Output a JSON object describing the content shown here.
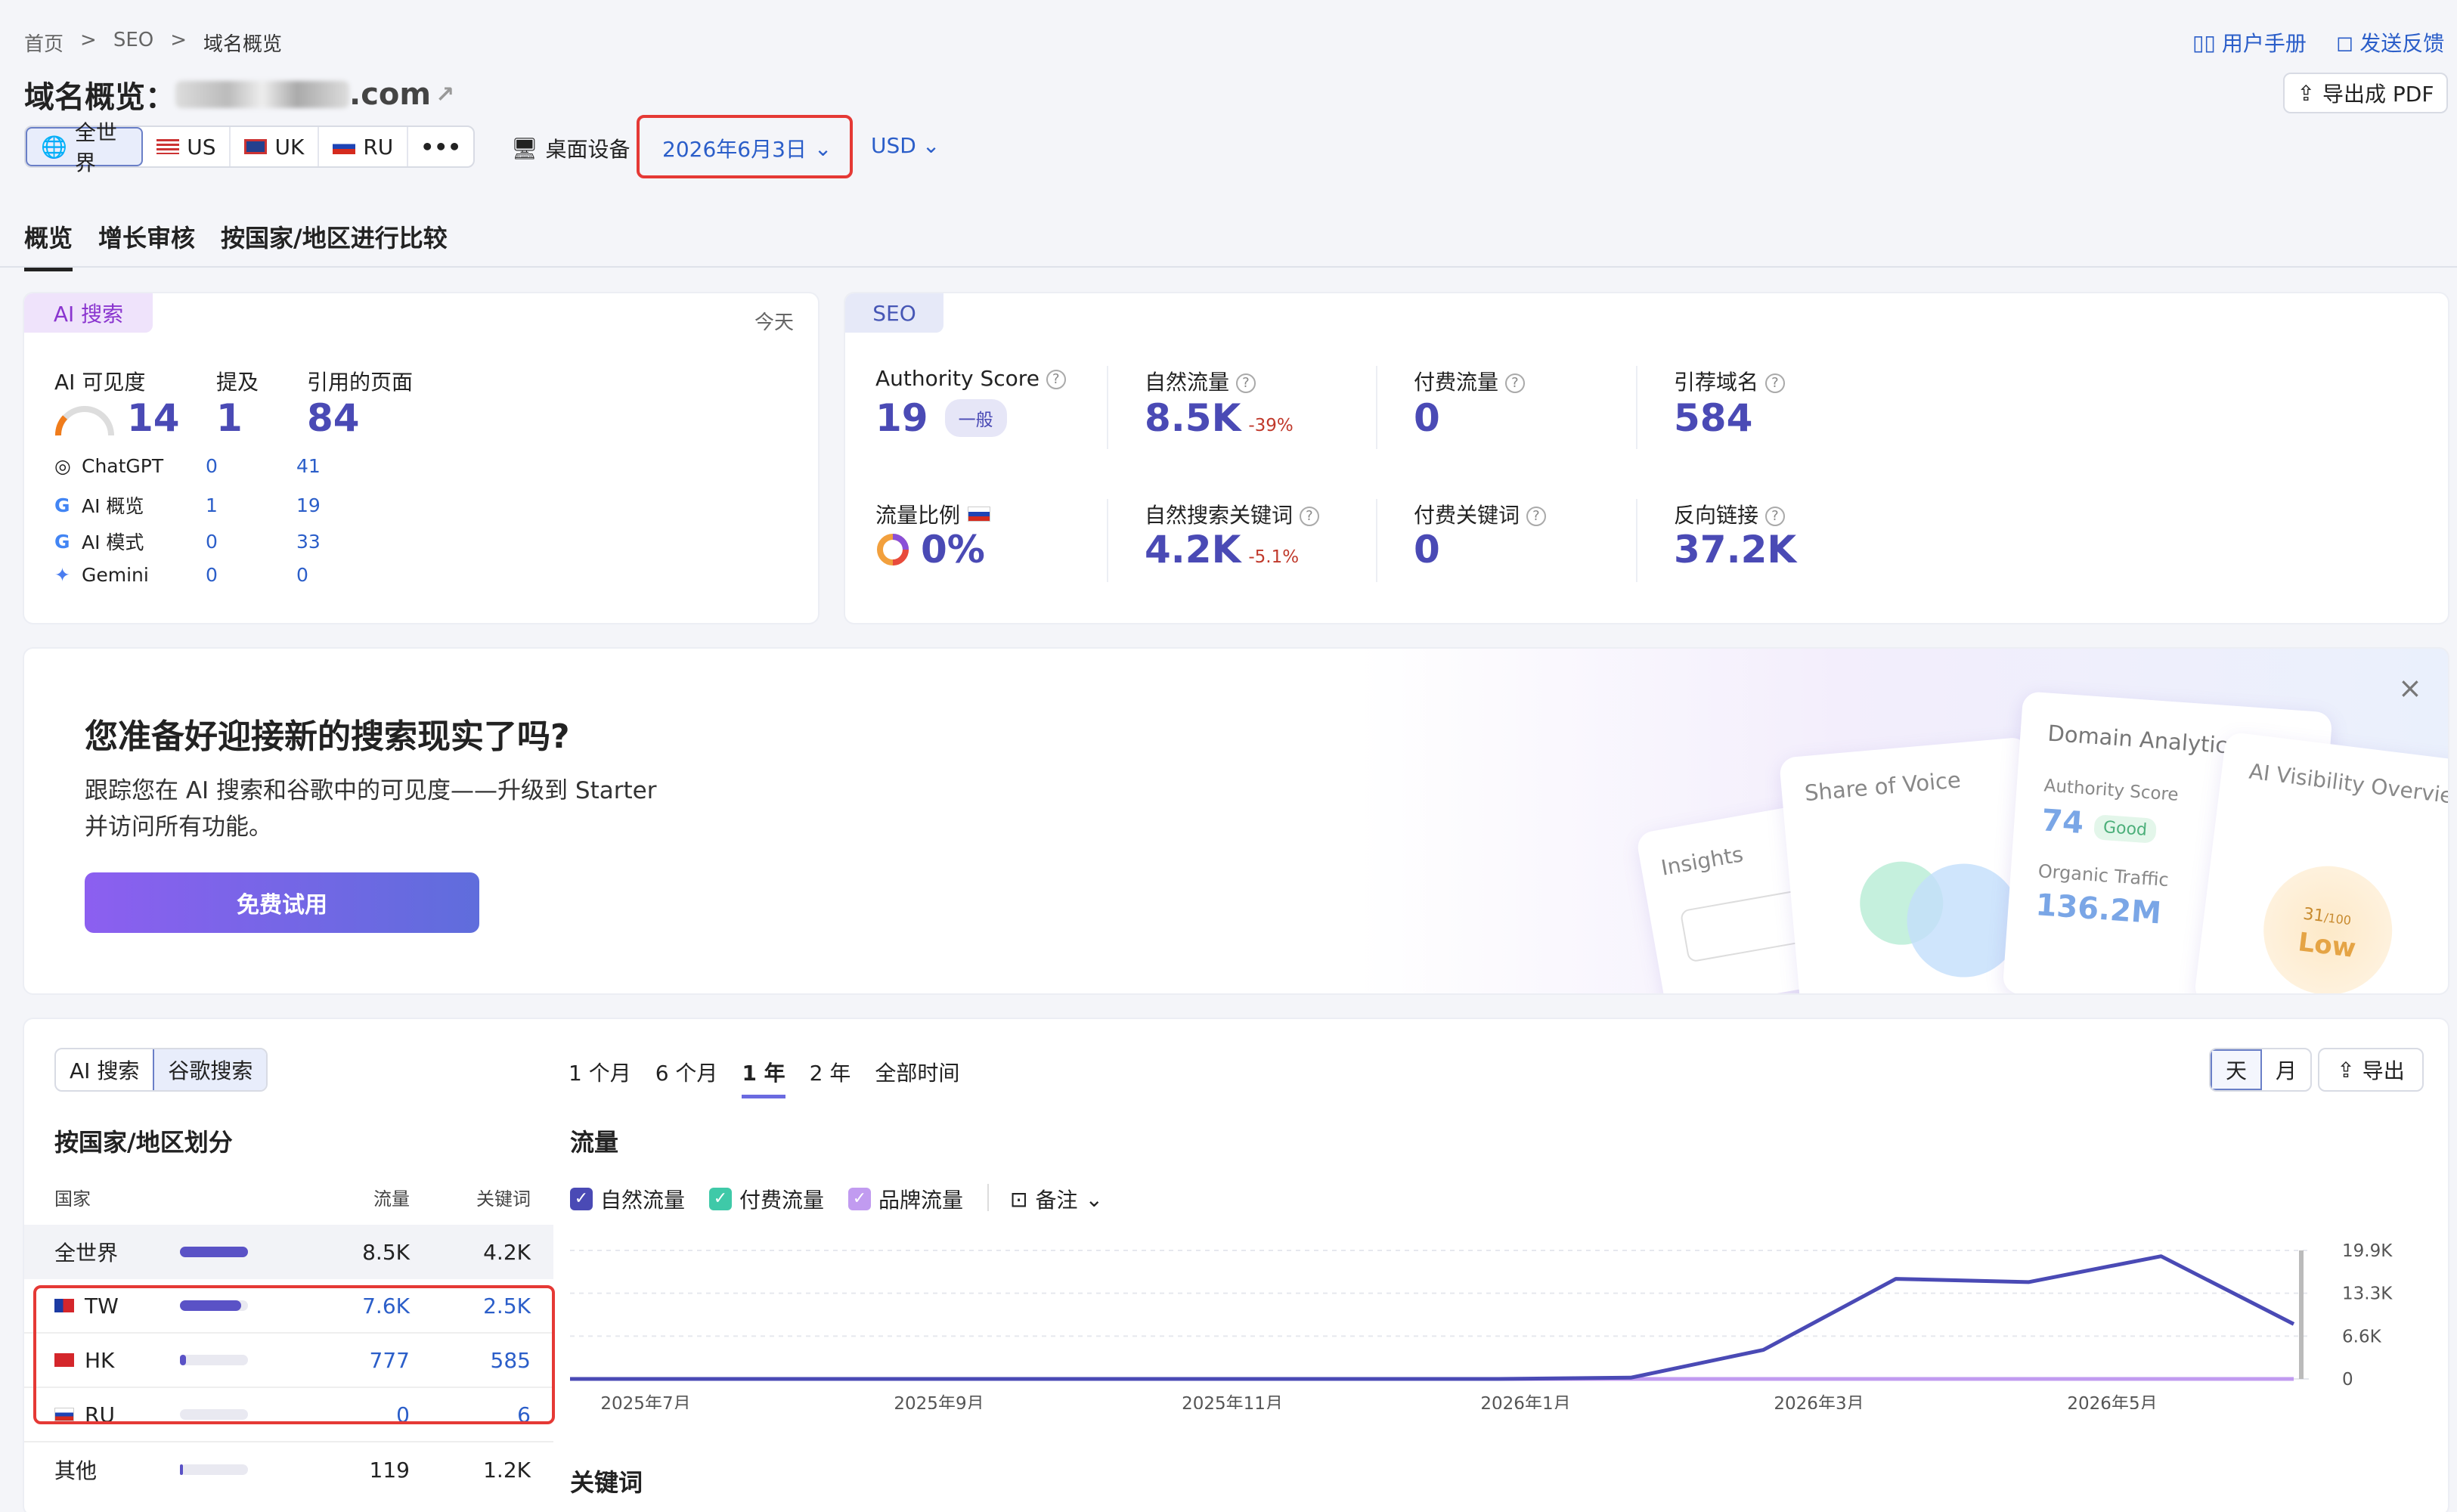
{
  "breadcrumb": {
    "home": "首页",
    "sep": ">",
    "seo": "SEO",
    "current": "域名概览"
  },
  "header": {
    "title": "域名概览：",
    "domain": ".com",
    "user_manual": "用户手册",
    "feedback": "发送反馈",
    "export_pdf": "导出成 PDF"
  },
  "filters": {
    "regions": [
      {
        "label": "全世界",
        "icon": "globe-icon"
      },
      {
        "label": "US",
        "icon": "us-flag-icon"
      },
      {
        "label": "UK",
        "icon": "uk-flag-icon"
      },
      {
        "label": "RU",
        "icon": "ru-flag-icon"
      }
    ],
    "more": "•••",
    "device": "桌面设备",
    "date": "2026年6月3日",
    "currency": "USD"
  },
  "tabs": [
    "概览",
    "增长审核",
    "按国家/地区进行比较"
  ],
  "ai_card": {
    "badge": "AI 搜索",
    "today": "今天",
    "headers": {
      "visibility": "AI 可见度",
      "mentions": "提及",
      "cited": "引用的页面"
    },
    "totals": {
      "visibility": "14",
      "mentions": "1",
      "cited": "84"
    },
    "rows": [
      {
        "name": "ChatGPT",
        "icon": "chatgpt-icon",
        "mentions": "0",
        "cited": "41"
      },
      {
        "name": "AI 概览",
        "icon": "google-icon",
        "mentions": "1",
        "cited": "19"
      },
      {
        "name": "AI 模式",
        "icon": "google-icon",
        "mentions": "0",
        "cited": "33"
      },
      {
        "name": "Gemini",
        "icon": "gemini-icon",
        "mentions": "0",
        "cited": "0"
      }
    ]
  },
  "seo_card": {
    "badge": "SEO",
    "authority_label": "Authority Score",
    "authority_value": "19",
    "authority_tag": "一般",
    "organic_label": "自然流量",
    "organic_value": "8.5K",
    "organic_change": "-39%",
    "paid_label": "付费流量",
    "paid_value": "0",
    "refdomains_label": "引荐域名",
    "refdomains_value": "584",
    "share_label": "流量比例",
    "share_value": "0%",
    "organic_kw_label": "自然搜索关键词",
    "organic_kw_value": "4.2K",
    "organic_kw_change": "-5.1%",
    "paid_kw_label": "付费关键词",
    "paid_kw_value": "0",
    "backlinks_label": "反向链接",
    "backlinks_value": "37.2K"
  },
  "promo": {
    "title": "您准备好迎接新的搜索现实了吗?",
    "line1": "跟踪您在 AI 搜索和谷歌中的可见度——升级到 Starter",
    "line2": "并访问所有功能。",
    "cta": "免费试用",
    "close": "×",
    "illustration": {
      "insights": "Insights",
      "share_voice": "Share of Voice",
      "domain_analytics": "Domain Analytics",
      "authority": "Authority Score",
      "authority_value": "74",
      "authority_tag": "Good",
      "organic": "Organic Traffic",
      "organic_value": "136.2M",
      "ai_vis": "AI Visibility Overview",
      "score": "31",
      "score_max": "/100",
      "low": "Low"
    }
  },
  "bottom": {
    "source_tabs": [
      "AI 搜索",
      "谷歌搜索"
    ],
    "periods": [
      "1 个月",
      "6 个月",
      "1 年",
      "2 年",
      "全部时间"
    ],
    "granularity": [
      "天",
      "月"
    ],
    "export": "导出",
    "country_title": "按国家/地区划分",
    "table_headers": {
      "country": "国家",
      "traffic": "流量",
      "keywords": "关键词"
    },
    "countries": [
      {
        "name": "全世界",
        "traffic": "8.5K",
        "keywords": "4.2K",
        "share": 1.0
      },
      {
        "name": "TW",
        "traffic": "7.6K",
        "keywords": "2.5K",
        "share": 0.9
      },
      {
        "name": "HK",
        "traffic": "777",
        "keywords": "585",
        "share": 0.09
      },
      {
        "name": "RU",
        "traffic": "0",
        "keywords": "6",
        "share": 0.0
      },
      {
        "name": "其他",
        "traffic": "119",
        "keywords": "1.2K",
        "share": 0.02
      }
    ],
    "traffic_title": "流量",
    "legend": [
      "自然流量",
      "付费流量",
      "品牌流量"
    ],
    "notes": "备注",
    "keywords_title": "关键词"
  },
  "chart_data": {
    "type": "line",
    "x": [
      "2025-06",
      "2025-07",
      "2025-08",
      "2025-09",
      "2025-10",
      "2025-11",
      "2025-12",
      "2026-01",
      "2026-02",
      "2026-03",
      "2026-04",
      "2026-05",
      "2026-06"
    ],
    "x_tick_labels": [
      "2025年7月",
      "2025年9月",
      "2025年11月",
      "2026年1月",
      "2026年3月",
      "2026年5月"
    ],
    "y_tick_labels": [
      "19.9K",
      "13.3K",
      "6.6K",
      "0"
    ],
    "ylim": [
      0,
      19900
    ],
    "series": [
      {
        "name": "自然流量",
        "color": "#4a4ab5",
        "values": [
          0,
          0,
          0,
          0,
          0,
          0,
          0,
          0,
          200,
          4500,
          15500,
          15000,
          19000,
          8500
        ]
      },
      {
        "name": "品牌流量",
        "color": "#c19bf0",
        "values": [
          0,
          0,
          0,
          0,
          0,
          0,
          0,
          0,
          0,
          0,
          0,
          0,
          0,
          0
        ]
      }
    ]
  }
}
